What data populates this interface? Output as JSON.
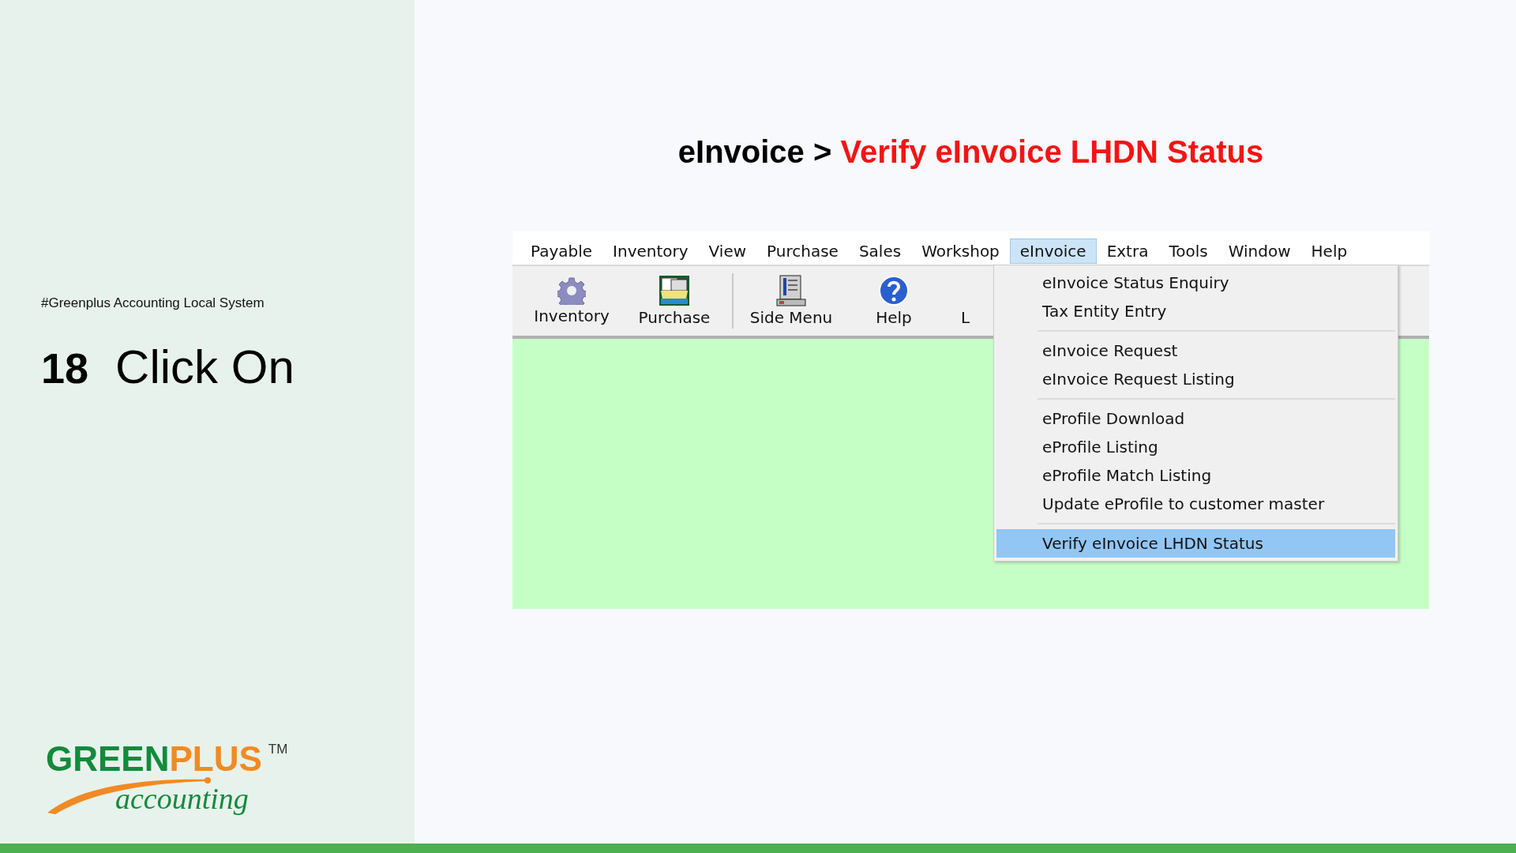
{
  "sidebar": {
    "tagline": "#Greenplus Accounting Local System",
    "step_number": "18",
    "instruction": "Click On",
    "logo": {
      "green_part": "GREEN",
      "orange_part": "PLUS",
      "trademark": "TM",
      "subtitle": "accounting"
    }
  },
  "title": {
    "path": "eInvoice >",
    "target": "Verify eInvoice LHDN Status"
  },
  "app": {
    "menu_bar": [
      {
        "label": "Payable",
        "selected": false
      },
      {
        "label": "Inventory",
        "selected": false
      },
      {
        "label": "View",
        "selected": false
      },
      {
        "label": "Purchase",
        "selected": false
      },
      {
        "label": "Sales",
        "selected": false
      },
      {
        "label": "Workshop",
        "selected": false
      },
      {
        "label": "eInvoice",
        "selected": true
      },
      {
        "label": "Extra",
        "selected": false
      },
      {
        "label": "Tools",
        "selected": false
      },
      {
        "label": "Window",
        "selected": false
      },
      {
        "label": "Help",
        "selected": false
      }
    ],
    "toolbar_groups": [
      [
        {
          "label": "Inventory"
        },
        {
          "label": "Purchase"
        }
      ],
      [
        {
          "label": "Side Menu"
        },
        {
          "label": "Help"
        },
        {
          "label": "L"
        }
      ]
    ],
    "dropdown_groups": [
      [
        {
          "label": "eInvoice Status Enquiry",
          "selected": false
        },
        {
          "label": "Tax Entity Entry",
          "selected": false
        }
      ],
      [
        {
          "label": "eInvoice Request",
          "selected": false
        },
        {
          "label": "eInvoice Request Listing",
          "selected": false
        }
      ],
      [
        {
          "label": "eProfile Download",
          "selected": false
        },
        {
          "label": "eProfile Listing",
          "selected": false
        },
        {
          "label": "eProfile Match Listing",
          "selected": false
        },
        {
          "label": "Update eProfile to customer master",
          "selected": false
        }
      ],
      [
        {
          "label": "Verify eInvoice LHDN Status",
          "selected": true
        }
      ]
    ]
  }
}
